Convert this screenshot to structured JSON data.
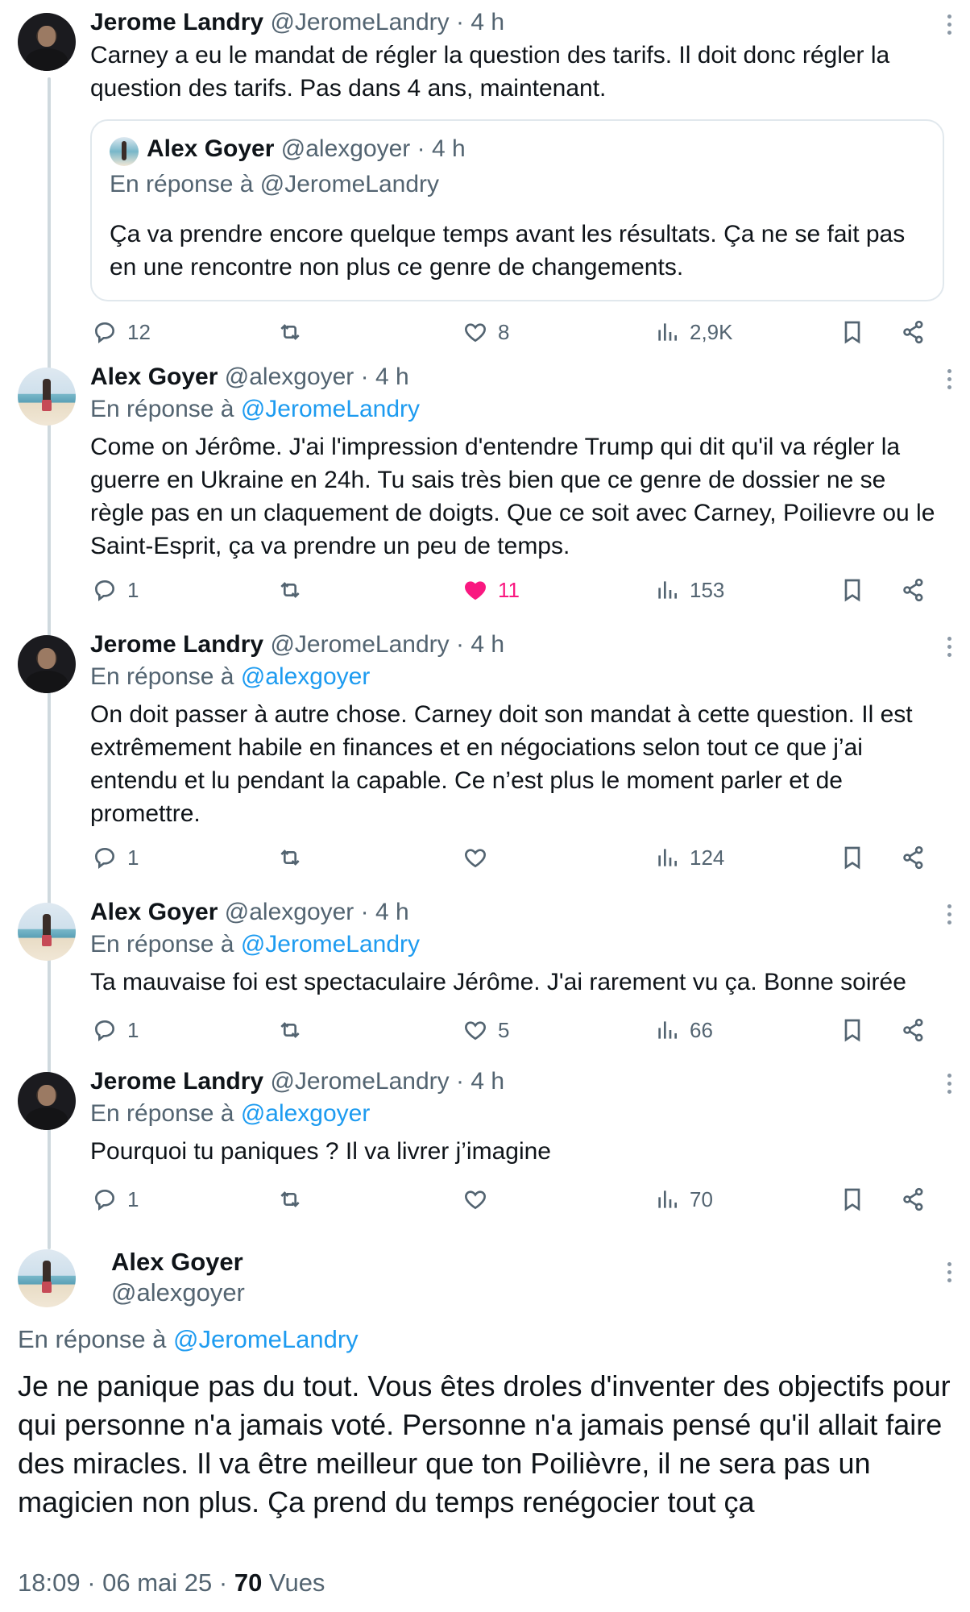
{
  "tweets": [
    {
      "name": "Jerome Landry",
      "handle": "@JeromeLandry",
      "time": "· 4 h",
      "reply_prefix": "",
      "reply_to": "",
      "body": "Carney a eu le mandat de régler la question des tarifs. Il doit donc régler la question des tarifs. Pas dans 4 ans, maintenant.",
      "quote": {
        "name": "Alex Goyer",
        "handle": "@alexgoyer",
        "time": "· 4 h",
        "reply_line": "En réponse à @JeromeLandry",
        "body": "Ça va prendre encore quelque temps avant les résultats. Ça ne se fait pas en une rencontre non plus ce genre de changements."
      },
      "replies": "12",
      "retweets": "",
      "likes": "8",
      "views": "2,9K"
    },
    {
      "name": "Alex Goyer",
      "handle": "@alexgoyer",
      "time": "· 4 h",
      "reply_prefix": "En réponse à",
      "reply_to": "@JeromeLandry",
      "body": "Come on Jérôme. J'ai l'impression d'entendre Trump qui dit qu'il va régler la guerre en Ukraine en 24h. Tu sais très bien que ce genre de dossier ne se règle pas en un claquement de doigts. Que ce soit avec Carney, Poilievre ou le Saint-Esprit, ça va prendre un peu de temps.",
      "replies": "1",
      "retweets": "",
      "likes": "11",
      "views": "153",
      "liked": true
    },
    {
      "name": "Jerome Landry",
      "handle": "@JeromeLandry",
      "time": "· 4 h",
      "reply_prefix": "En réponse à",
      "reply_to": "@alexgoyer",
      "body": "On doit passer à autre chose. Carney doit son mandat à cette question. Il est extrêmement habile en finances et en négociations selon tout ce que j’ai entendu et lu pendant la capable. Ce n’est plus le moment parler et de promettre.",
      "replies": "1",
      "retweets": "",
      "likes": "",
      "views": "124"
    },
    {
      "name": "Alex Goyer",
      "handle": "@alexgoyer",
      "time": "· 4 h",
      "reply_prefix": "En réponse à",
      "reply_to": "@JeromeLandry",
      "body": "Ta mauvaise foi est spectaculaire Jérôme. J'ai rarement vu ça. Bonne soirée",
      "replies": "1",
      "retweets": "",
      "likes": "5",
      "views": "66"
    },
    {
      "name": "Jerome Landry",
      "handle": "@JeromeLandry",
      "time": "· 4 h",
      "reply_prefix": "En réponse à",
      "reply_to": "@alexgoyer",
      "body": "Pourquoi tu paniques ? Il va livrer j’imagine",
      "replies": "1",
      "retweets": "",
      "likes": "",
      "views": "70"
    }
  ],
  "final": {
    "name": "Alex Goyer",
    "handle": "@alexgoyer",
    "reply_prefix": "En réponse à",
    "reply_to": "@JeromeLandry",
    "body": "Je ne panique pas du tout. Vous êtes droles d'inventer des objectifs pour qui personne n'a jamais voté. Personne n'a jamais pensé qu'il allait faire des miracles. Il va être meilleur que ton Poilièvre, il ne sera pas un magicien non plus. Ça prend du temps renégocier tout ça",
    "meta_prefix": "18:09 · 06 mai 25 · ",
    "views_count": "70",
    "views_label": " Vues"
  },
  "colors": {
    "link": "#1d9bf0",
    "like_active": "#f91880",
    "muted": "#536471"
  },
  "icons": [
    "reply-icon",
    "retweet-icon",
    "like-icon",
    "views-icon",
    "bookmark-icon",
    "share-icon",
    "more-icon"
  ]
}
